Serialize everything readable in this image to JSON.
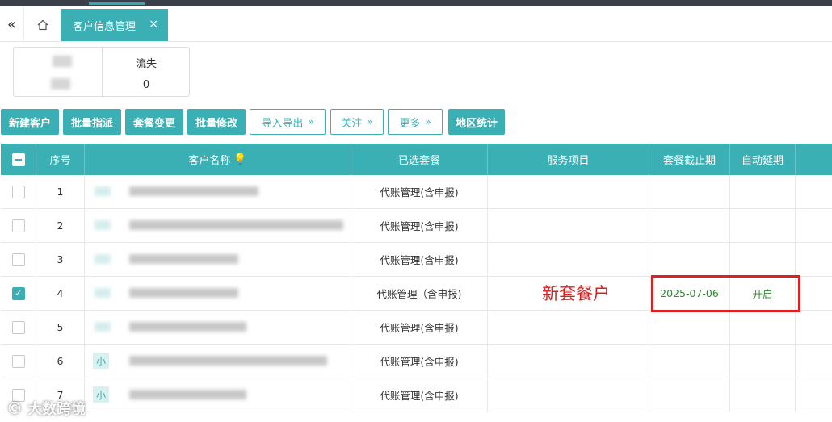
{
  "tabs": {
    "active_tab_label": "客户信息管理",
    "close_glyph": "×",
    "collapse_glyph": "«",
    "home_icon": "home-icon"
  },
  "stats": {
    "label": "流失",
    "value": "0"
  },
  "toolbar": {
    "new_customer": "新建客户",
    "batch_assign": "批量指派",
    "plan_change": "套餐变更",
    "batch_edit": "批量修改",
    "import_export": "导入导出",
    "follow": "关注",
    "more": "更多",
    "region_stats": "地区统计",
    "chevron": "»"
  },
  "table": {
    "columns": {
      "seq": "序号",
      "customer_name": "客户名称",
      "selected_plan": "已选套餐",
      "service_items": "服务项目",
      "plan_deadline": "套餐截止期",
      "auto_extend": "自动延期"
    },
    "rows": [
      {
        "seq": "1",
        "plan": "代账管理(含申报)",
        "deadline": "",
        "auto_extend": "",
        "checked": false,
        "tag": ""
      },
      {
        "seq": "2",
        "plan": "代账管理(含申报)",
        "deadline": "",
        "auto_extend": "",
        "checked": false,
        "tag": ""
      },
      {
        "seq": "3",
        "plan": "代账管理(含申报)",
        "deadline": "",
        "auto_extend": "",
        "checked": false,
        "tag": ""
      },
      {
        "seq": "4",
        "plan": "代账管理（含申报)",
        "deadline": "2025-07-06",
        "auto_extend": "开启",
        "checked": true,
        "tag": ""
      },
      {
        "seq": "5",
        "plan": "代账管理(含申报)",
        "deadline": "",
        "auto_extend": "",
        "checked": false,
        "tag": ""
      },
      {
        "seq": "6",
        "plan": "代账管理(含申报)",
        "deadline": "",
        "auto_extend": "",
        "checked": false,
        "tag": "小"
      },
      {
        "seq": "7",
        "plan": "代账管理(含申报)",
        "deadline": "",
        "auto_extend": "",
        "checked": false,
        "tag": "小"
      }
    ]
  },
  "annotation": {
    "text": "新套餐户",
    "color": "#d82020"
  },
  "watermark": {
    "text": "大数跨境"
  },
  "colors": {
    "accent": "#3ab0b5",
    "green_text": "#2c8a2c",
    "highlight_border": "#e02020"
  }
}
